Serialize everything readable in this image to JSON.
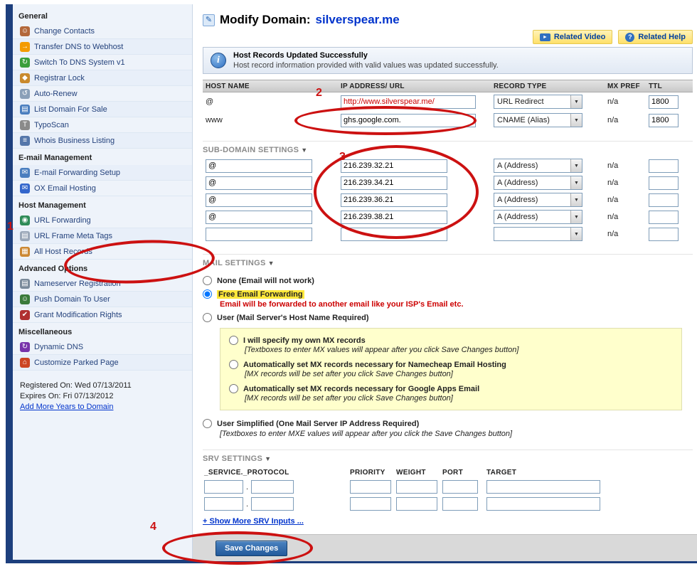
{
  "colors": {
    "annotation": "#cc1111",
    "highlight": "#ffe83a",
    "note": "#cc0000",
    "link": "#0033cc",
    "domain": "#0033cc"
  },
  "annotations": {
    "n1": "1",
    "n2": "2",
    "n3": "3",
    "n4": "4"
  },
  "sidebar": {
    "sections": [
      {
        "title": "General",
        "items": [
          {
            "label": "Change Contacts",
            "icon": "change-contacts-icon"
          },
          {
            "label": "Transfer DNS to Webhost",
            "icon": "transfer-dns-icon"
          },
          {
            "label": "Switch To DNS System v1",
            "icon": "switch-dns-icon"
          },
          {
            "label": "Registrar Lock",
            "icon": "registrar-lock-icon"
          },
          {
            "label": "Auto-Renew",
            "icon": "auto-renew-icon"
          },
          {
            "label": "List Domain For Sale",
            "icon": "list-domain-icon"
          },
          {
            "label": "TypoScan",
            "icon": "typoscan-icon"
          },
          {
            "label": "Whois Business Listing",
            "icon": "whois-listing-icon"
          }
        ]
      },
      {
        "title": "E-mail Management",
        "items": [
          {
            "label": "E-mail Forwarding Setup",
            "icon": "email-forwarding-icon"
          },
          {
            "label": "OX Email Hosting",
            "icon": "ox-email-icon"
          }
        ]
      },
      {
        "title": "Host Management",
        "items": [
          {
            "label": "URL Forwarding",
            "icon": "url-forwarding-icon"
          },
          {
            "label": "URL Frame Meta Tags",
            "icon": "url-frame-icon"
          },
          {
            "label": "All Host Records",
            "icon": "all-host-records-icon"
          }
        ]
      },
      {
        "title": "Advanced Options",
        "items": [
          {
            "label": "Nameserver Registration",
            "icon": "nameserver-registration-icon"
          },
          {
            "label": "Push Domain To User",
            "icon": "push-domain-icon"
          },
          {
            "label": "Grant Modification Rights",
            "icon": "grant-rights-icon"
          }
        ]
      },
      {
        "title": "Miscellaneous",
        "items": [
          {
            "label": "Dynamic DNS",
            "icon": "dynamic-dns-icon"
          },
          {
            "label": "Customize Parked Page",
            "icon": "parked-page-icon"
          }
        ]
      }
    ],
    "registered_on": "Registered On: Wed 07/13/2011",
    "expires_on": "Expires On: Fri 07/13/2012",
    "add_years": "Add More Years to Domain"
  },
  "header": {
    "title": "Modify Domain:",
    "domain": "silverspear.me",
    "related_video": "Related Video",
    "related_help": "Related Help"
  },
  "notice": {
    "title": "Host Records Updated Successfully",
    "message": "Host record information provided with valid values was updated successfully."
  },
  "host_table": {
    "headers": {
      "host": "HOST NAME",
      "ip": "IP ADDRESS/ URL",
      "type": "RECORD TYPE",
      "mx": "MX PREF",
      "ttl": "TTL"
    },
    "rows": [
      {
        "host": "@",
        "value": "http://www.silverspear.me/",
        "type": "URL Redirect",
        "mx": "n/a",
        "ttl": "1800"
      },
      {
        "host": "www",
        "value": "ghs.google.com.",
        "type": "CNAME (Alias)",
        "mx": "n/a",
        "ttl": "1800"
      }
    ]
  },
  "subdomain": {
    "title": "SUB-DOMAIN SETTINGS",
    "rows": [
      {
        "host": "@",
        "value": "216.239.32.21",
        "type": "A (Address)",
        "mx": "n/a",
        "ttl": ""
      },
      {
        "host": "@",
        "value": "216.239.34.21",
        "type": "A (Address)",
        "mx": "n/a",
        "ttl": ""
      },
      {
        "host": "@",
        "value": "216.239.36.21",
        "type": "A (Address)",
        "mx": "n/a",
        "ttl": ""
      },
      {
        "host": "@",
        "value": "216.239.38.21",
        "type": "A (Address)",
        "mx": "n/a",
        "ttl": ""
      },
      {
        "host": "",
        "value": "",
        "type": "",
        "mx": "n/a",
        "ttl": ""
      }
    ]
  },
  "mail": {
    "title": "MAIL SETTINGS",
    "none_label": "None (Email will not work)",
    "forwarding_label": "Free Email Forwarding",
    "forwarding_note": "Email will be forwarded to another email like your ISP's Email etc.",
    "user_label": "User (Mail Server's Host Name Required)",
    "mx_options": [
      {
        "label": "I will specify my own MX records",
        "note": "[Textboxes to enter MX values will appear after you click Save Changes button]"
      },
      {
        "label": "Automatically set MX records necessary for Namecheap Email Hosting",
        "note": "[MX records will be set after you click Save Changes button]"
      },
      {
        "label": "Automatically set MX records necessary for Google Apps Email",
        "note": "[MX records will be set after you click Save Changes button]"
      }
    ],
    "simplified_label": "User Simplified (One Mail Server IP Address Required)",
    "simplified_note": "[Textboxes to enter MXE values will appear after you click the Save Changes button]"
  },
  "srv": {
    "title": "SRV SETTINGS",
    "headers": {
      "service_protocol": "_SERVICE._PROTOCOL",
      "priority": "PRIORITY",
      "weight": "WEIGHT",
      "port": "PORT",
      "target": "TARGET"
    },
    "show_more": "+ Show More SRV Inputs ..."
  },
  "footer": {
    "save": "Save Changes"
  }
}
